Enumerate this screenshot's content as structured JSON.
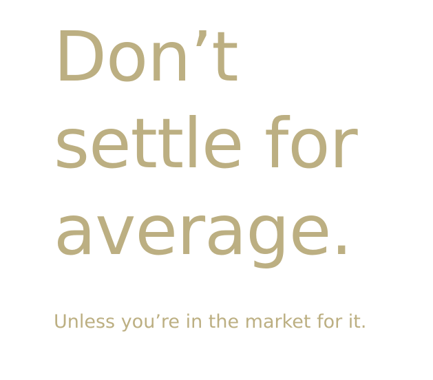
{
  "hero": {
    "headline_lines": [
      "Don’t",
      "settle for",
      "average."
    ],
    "subline": "Unless you’re in the market for it."
  },
  "colors": {
    "text_gold": "#bcaf82",
    "background": "#ffffff"
  }
}
